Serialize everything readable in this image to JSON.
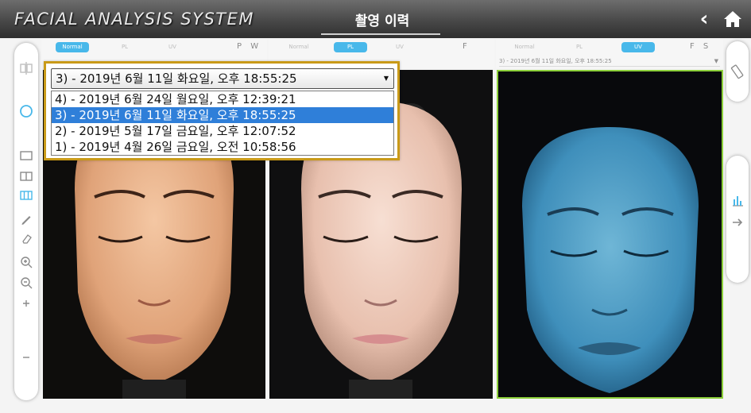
{
  "header": {
    "app_title": "FACIAL ANALYSIS SYSTEM",
    "screen_title": "촬영 이력",
    "back_icon": "chevron-left-icon",
    "home_icon": "home-icon"
  },
  "left_toolbar": {
    "icons": [
      "compare-icon",
      "circle-icon",
      "layout-single-icon",
      "layout-double-icon",
      "layout-triple-icon",
      "pen-icon",
      "eraser-icon",
      "zoom-in-icon",
      "zoom-out-icon",
      "plus-icon",
      "minus-icon"
    ]
  },
  "right_toolbar": {
    "icons": [
      "ruler-icon",
      "bar-chart-icon",
      "arrow-right-icon"
    ]
  },
  "columns": [
    {
      "modes": [
        "Normal",
        "PL",
        "UV"
      ],
      "active_mode": "Normal",
      "letters": "P W"
    },
    {
      "modes": [
        "Normal",
        "PL",
        "UV"
      ],
      "active_mode": "PL",
      "letters": "F"
    },
    {
      "modes": [
        "Normal",
        "PL",
        "UV"
      ],
      "active_mode": "UV",
      "letters": "F S",
      "select_value": "3) - 2019년 6월 11일 화요일, 오후 18:55:25"
    }
  ],
  "date_dropdown": {
    "selected": "3) - 2019년 6월 11일 화요일, 오후 18:55:25",
    "options": [
      "4) - 2019년 6월 24일 월요일, 오후 12:39:21",
      "3) - 2019년 6월 11일 화요일, 오후 18:55:25",
      "2) - 2019년 5월 17일 금요일, 오후 12:07:52",
      "1) - 2019년 4월 26일 금요일, 오전 10:58:56"
    ],
    "highlighted_index": 1
  },
  "colors": {
    "accent": "#48b8ea",
    "dropdown_border": "#c99a18",
    "selection": "#2f7fd9",
    "active_panel_border": "#8ccf3a"
  }
}
